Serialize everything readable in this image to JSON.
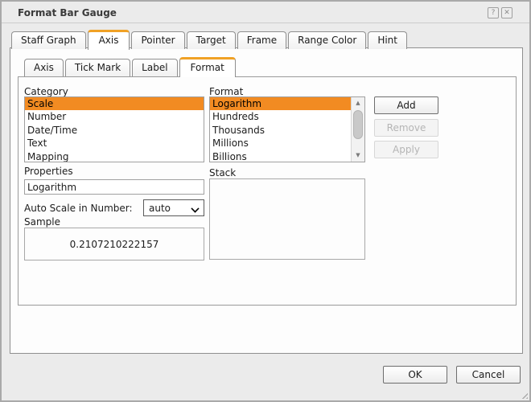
{
  "dialog": {
    "title": "Format Bar Gauge",
    "help_glyph": "?",
    "close_glyph": "✕",
    "accent_color": "#f0a125",
    "selection_color": "#f28b22"
  },
  "tabs": [
    {
      "label": "Staff Graph"
    },
    {
      "label": "Axis",
      "active": true
    },
    {
      "label": "Pointer"
    },
    {
      "label": "Target"
    },
    {
      "label": "Frame"
    },
    {
      "label": "Range Color"
    },
    {
      "label": "Hint"
    }
  ],
  "subtabs": [
    {
      "label": "Axis"
    },
    {
      "label": "Tick Mark"
    },
    {
      "label": "Label"
    },
    {
      "label": "Format",
      "active": true
    }
  ],
  "panel": {
    "category": {
      "label": "Category",
      "items": [
        "Scale",
        "Number",
        "Date/Time",
        "Text",
        "Mapping"
      ],
      "selected": "Scale"
    },
    "format": {
      "label": "Format",
      "items": [
        "Logarithm",
        "Hundreds",
        "Thousands",
        "Millions",
        "Billions"
      ],
      "selected": "Logarithm",
      "scroll_up_glyph": "▲",
      "scroll_down_glyph": "▼"
    },
    "buttons": {
      "add": "Add",
      "remove": "Remove",
      "apply": "Apply"
    },
    "properties": {
      "label": "Properties",
      "value": "Logarithm"
    },
    "auto_scale": {
      "label": "Auto Scale in Number:",
      "value": "auto"
    },
    "sample": {
      "label": "Sample",
      "value": "0.2107210222157"
    },
    "stack": {
      "label": "Stack"
    }
  },
  "footer": {
    "ok": "OK",
    "cancel": "Cancel"
  }
}
